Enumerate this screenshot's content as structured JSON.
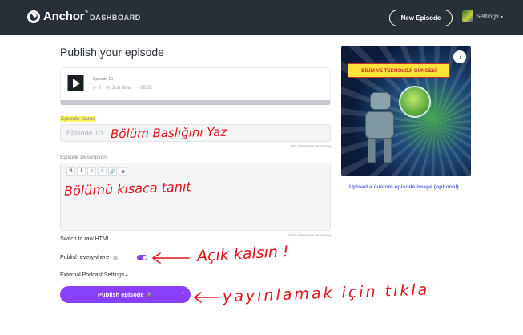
{
  "header": {
    "logo_text": "Anchor",
    "logo_reg": "®",
    "nav_dashboard": "DASHBOARD",
    "new_episode_label": "New Episode",
    "settings_label": "Settings",
    "settings_caret": "▾"
  },
  "page": {
    "title": "Publish your episode"
  },
  "episode_card": {
    "title": "Episode 10",
    "plays": "0",
    "posted": "Just Now",
    "duration": "06:32"
  },
  "form": {
    "name_label": "Episode Name",
    "name_value": "Episode 10",
    "name_chars": "200 characters remaining",
    "desc_label": "Episode Description",
    "desc_chars": "4000 characters remaining",
    "toolbar": [
      "B",
      "I",
      "≡",
      "≡",
      "🔗",
      "⊘"
    ],
    "raw_html_label": "Switch to raw HTML",
    "publish_everywhere_label": "Publish everywhere",
    "publish_everywhere_on": true,
    "external_settings_label": "External Podcast Settings",
    "external_settings_caret": "▸",
    "publish_button_label": "Publish episode 🚀",
    "publish_caret": "▾"
  },
  "artwork": {
    "banner_text": "BİLİM VE  TEKNOLOJİ GÜNCESİ",
    "upload_label": "Upload a custom episode image (optional)"
  },
  "annotations": {
    "name_note": "Bölüm Başlığını Yaz",
    "desc_note": "Bölümü kısaca tanıt",
    "toggle_note": "Açık kalsın !",
    "publish_note": "yayınlamak için tıkla"
  },
  "colors": {
    "topbar": "#292f36",
    "accent": "#8940fa",
    "annotation": "#e0141c",
    "highlight": "#fff565"
  }
}
